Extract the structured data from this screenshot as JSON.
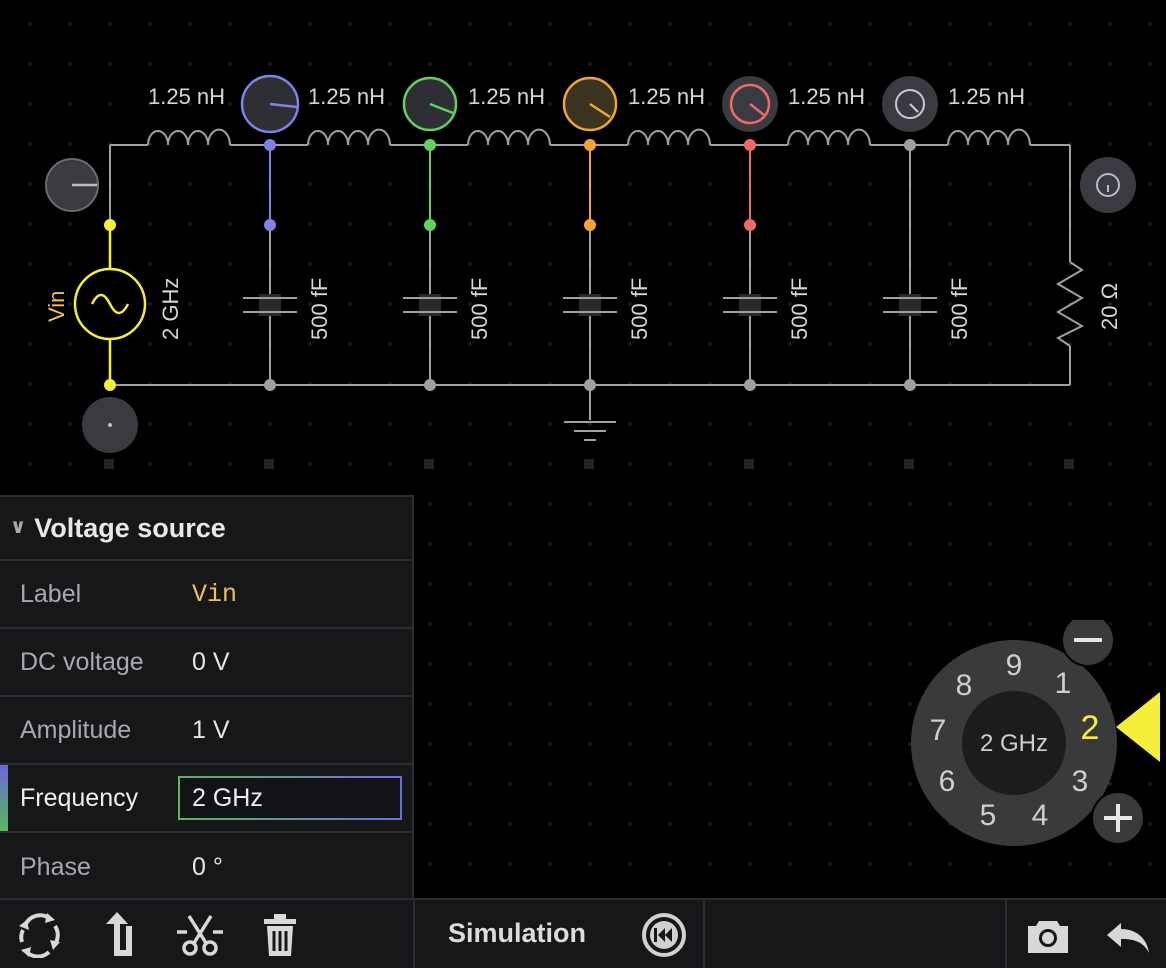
{
  "circuit": {
    "inductor_label": "1.25 nH",
    "capacitor_label": "500 fF",
    "source_name": "Vin",
    "source_freq": "2 GHz",
    "resistor_label": "20 Ω",
    "colors": {
      "wire": "#a0a0a0",
      "source": "#f5ee3a",
      "probe1": "#7d82e8",
      "probe2": "#63d060",
      "probe3": "#f2a43a",
      "probe4": "#ee6a68",
      "probe5": "#b4b4b8"
    }
  },
  "panel": {
    "title": "Voltage source",
    "rows": [
      {
        "key": "Label",
        "value": "Vin"
      },
      {
        "key": "DC voltage",
        "value": "0 V"
      },
      {
        "key": "Amplitude",
        "value": "1 V"
      },
      {
        "key": "Frequency",
        "value": "2 GHz"
      },
      {
        "key": "Phase",
        "value": "0 °"
      }
    ]
  },
  "dial": {
    "center_label": "2 GHz",
    "numbers": [
      "9",
      "1",
      "2",
      "3",
      "4",
      "5",
      "6",
      "7",
      "8"
    ],
    "selected": "2",
    "minus_icon": "minus-icon",
    "plus_icon": "plus-icon"
  },
  "toolbar": {
    "simulation_label": "Simulation",
    "icons": [
      "rotate-icon",
      "flip-icon",
      "cut-icon",
      "trash-icon",
      "rewind-icon",
      "camera-icon",
      "undo-icon"
    ]
  }
}
